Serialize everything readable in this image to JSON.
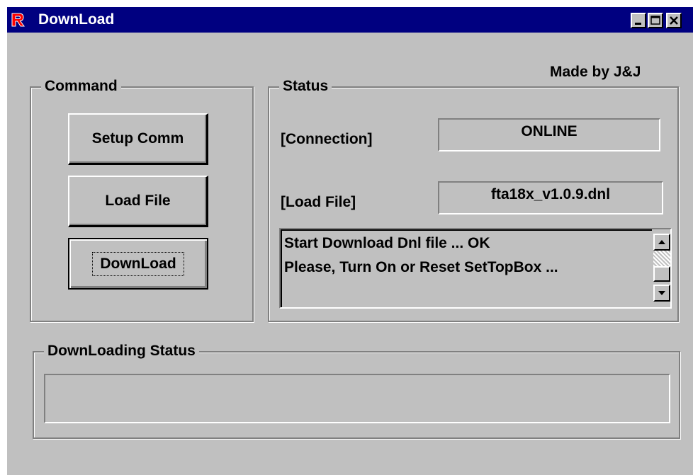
{
  "window": {
    "title": "DownLoad",
    "credit": "Made by J&J"
  },
  "titlebar": {
    "icons": [
      "app-r-icon",
      "minimize-icon",
      "maximize-icon",
      "close-icon"
    ]
  },
  "command": {
    "label": "Command",
    "setup_label": "Setup Comm",
    "load_label": "Load File",
    "download_label": "DownLoad"
  },
  "status": {
    "label": "Status",
    "connection_label": "[Connection]",
    "connection_value": "ONLINE",
    "loadfile_label": "[Load File]",
    "loadfile_value": "fta18x_v1.0.9.dnl",
    "log": [
      "Start Download Dnl file ... OK",
      "Please, Turn On or Reset SetTopBox ..."
    ]
  },
  "downloading": {
    "label": "DownLoading Status",
    "progress": 0
  },
  "colors": {
    "titlebar": "#000080",
    "face": "#c0c0c0",
    "icon_red": "#ff0000"
  }
}
